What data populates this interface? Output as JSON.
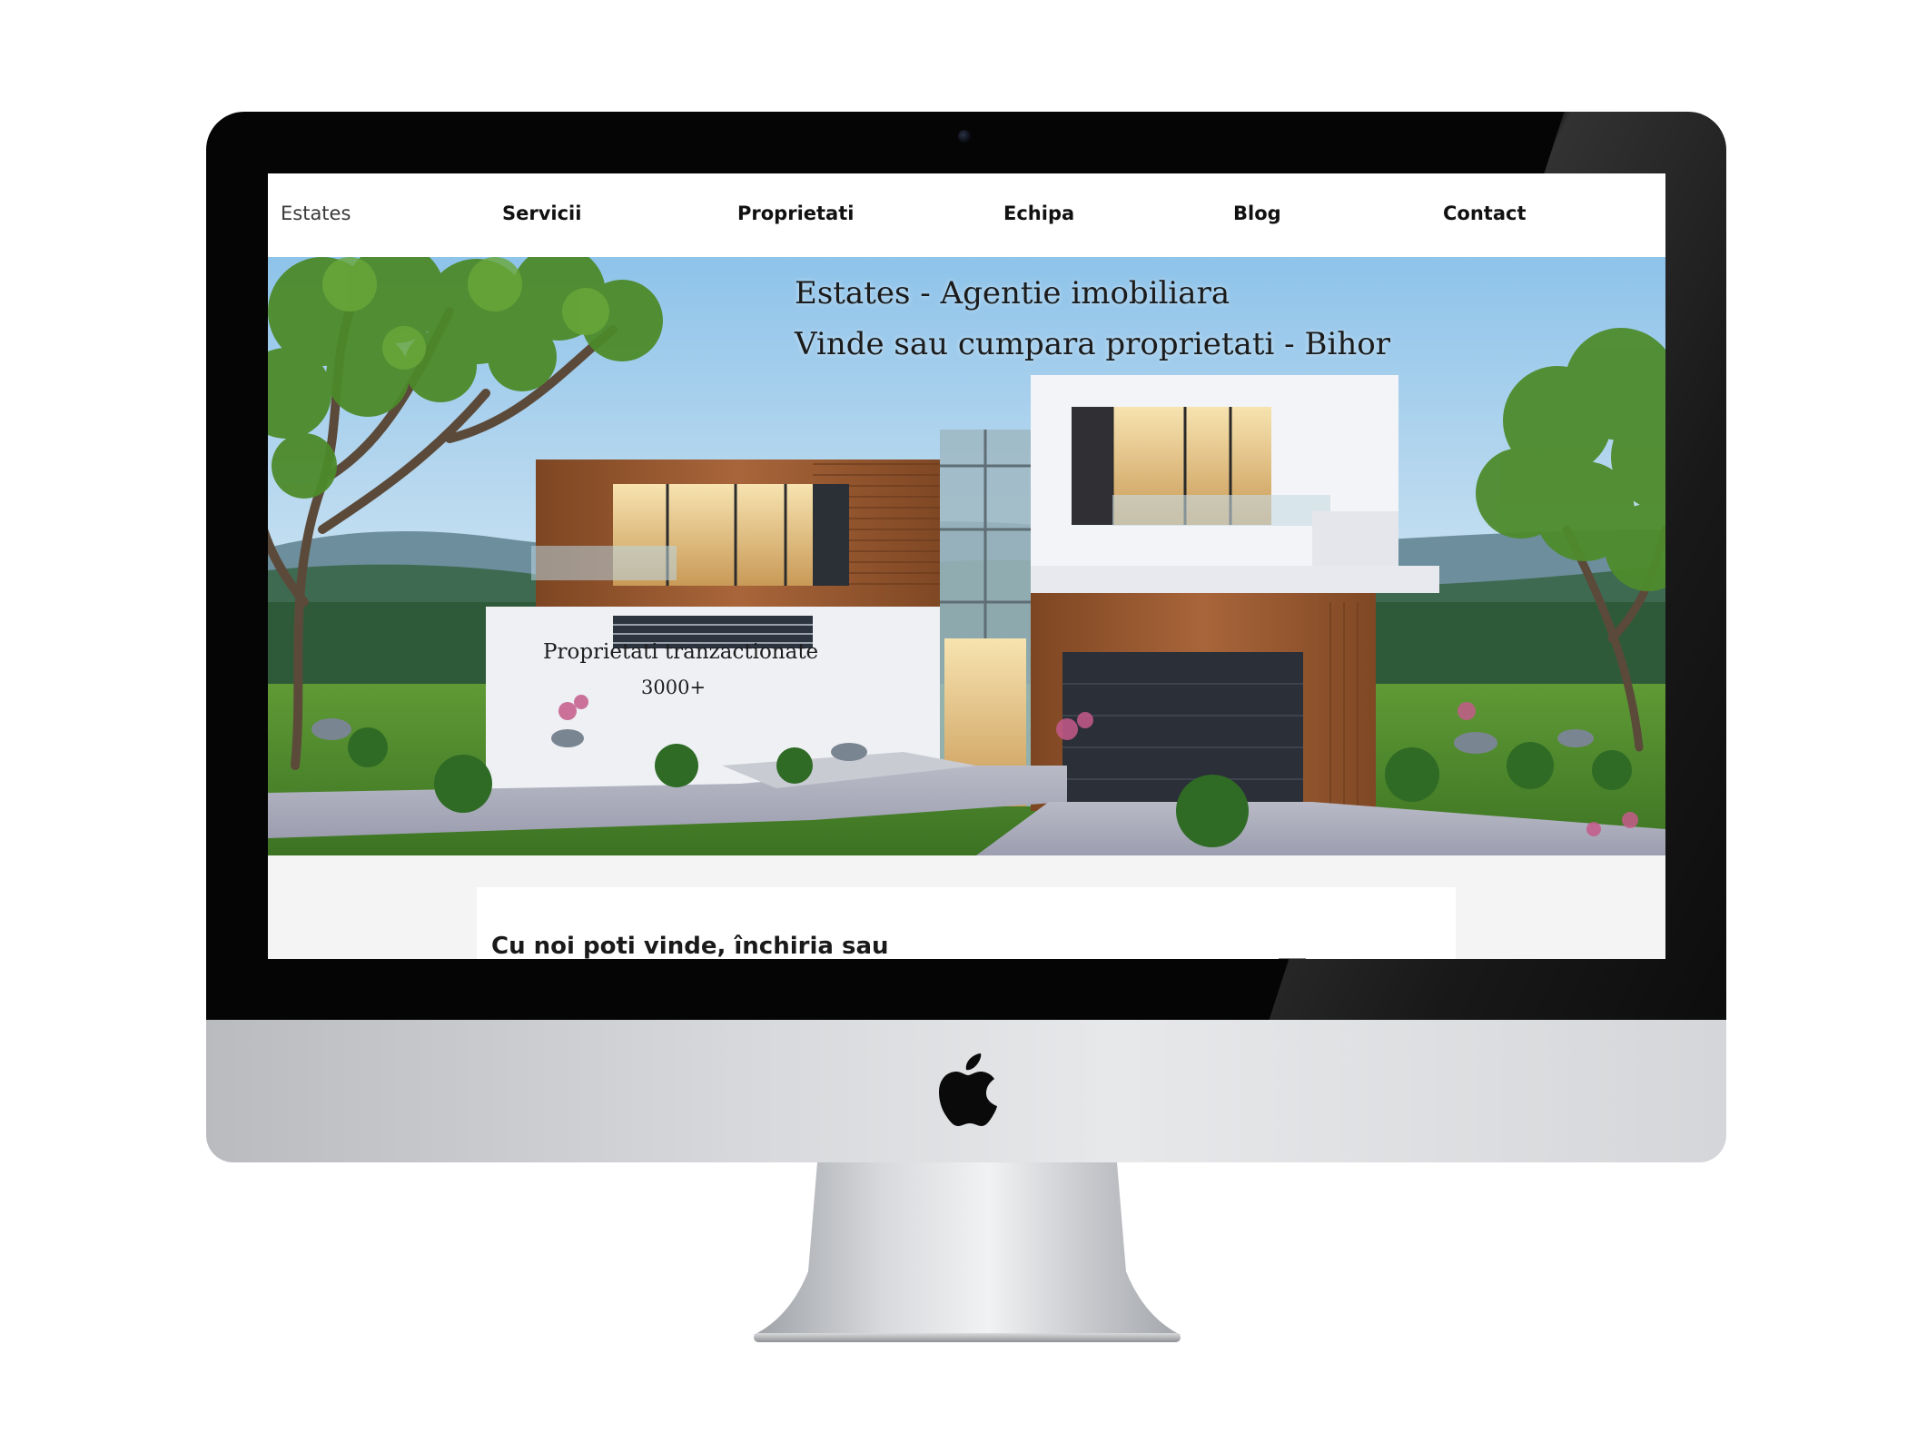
{
  "nav": {
    "brand": "Estates",
    "items": [
      {
        "label": "Servicii"
      },
      {
        "label": "Proprietati"
      },
      {
        "label": "Echipa"
      },
      {
        "label": "Blog"
      },
      {
        "label": "Contact"
      }
    ]
  },
  "hero": {
    "title": "Estates - Agentie imobiliara",
    "subtitle": "Vinde sau cumpara proprietati - Bihor",
    "stat_label": "Proprietati tranzactionate",
    "stat_value": "3000+"
  },
  "content": {
    "heading": "Cu noi poti vinde, închiria sau"
  },
  "colors": {
    "bezel": "#050505",
    "sky": "#9fc9ea",
    "lawn": "#4f8a2e",
    "wood": "#9a5a2e"
  }
}
